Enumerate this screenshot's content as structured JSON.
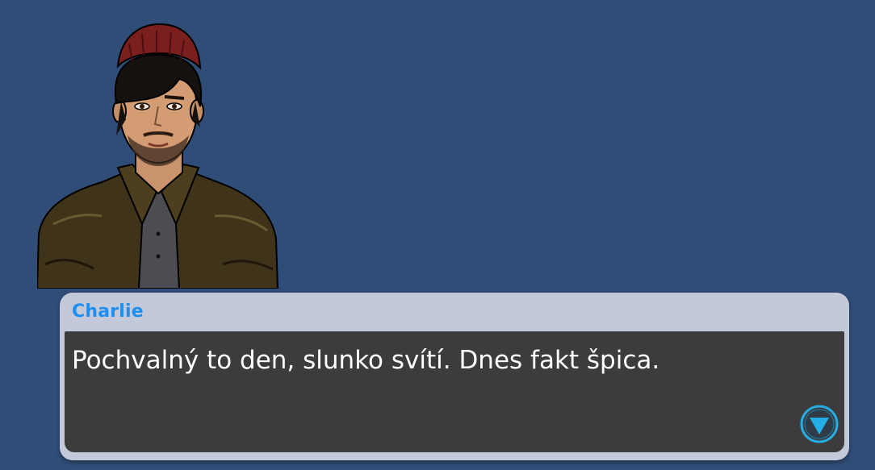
{
  "dialog": {
    "speaker": "Charlie",
    "text": "Pochvalný to den, slunko svítí. Dnes fakt špica."
  },
  "colors": {
    "background": "#304d78",
    "speaker_name": "#1d8ff2",
    "dialog_frame": "#c3c9d8",
    "dialog_body": "#3c3c3c",
    "dialog_text": "#ffffff",
    "advance_button": "#25aee6"
  },
  "icons": {
    "advance": "triangle-down-icon"
  }
}
